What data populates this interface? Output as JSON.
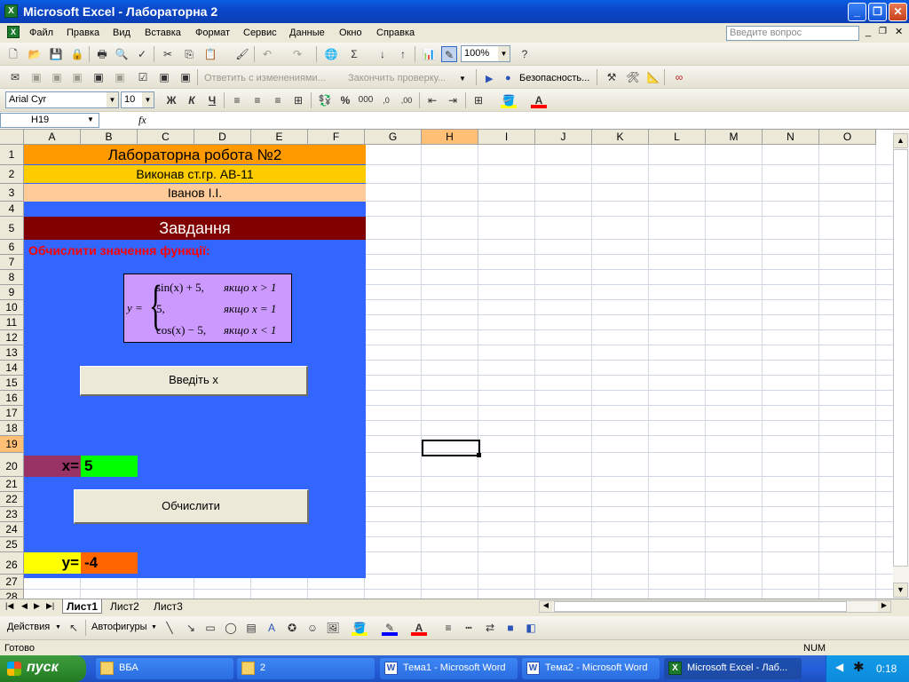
{
  "window": {
    "title": "Microsoft Excel - Лабораторна 2"
  },
  "menu": {
    "items": [
      "Файл",
      "Правка",
      "Вид",
      "Вставка",
      "Формат",
      "Сервис",
      "Данные",
      "Окно",
      "Справка"
    ],
    "ask_placeholder": "Введите вопрос"
  },
  "toolbar": {
    "zoom": "100%",
    "reply_label": "Ответить с изменениями...",
    "finish_label": "Закончить проверку...",
    "security_label": "Безопасность..."
  },
  "format_bar": {
    "font": "Arial Cyr",
    "size": "10",
    "bold": "Ж",
    "italic": "К",
    "underline": "Ч",
    "percent": "%",
    "thousands": "000"
  },
  "formula_bar": {
    "name_box": "H19",
    "fx": "fx",
    "value": ""
  },
  "grid": {
    "columns": [
      "A",
      "B",
      "C",
      "D",
      "E",
      "F",
      "G",
      "H",
      "I",
      "J",
      "K",
      "L",
      "M",
      "N",
      "O"
    ],
    "rows": [
      "1",
      "2",
      "3",
      "4",
      "5",
      "6",
      "7",
      "8",
      "9",
      "10",
      "11",
      "12",
      "13",
      "14",
      "15",
      "16",
      "17",
      "18",
      "19",
      "20",
      "21",
      "22",
      "23",
      "24",
      "25",
      "26",
      "27",
      "28"
    ],
    "selected_col": "H",
    "selected_row": "19"
  },
  "sheet": {
    "title": "Лабораторна робота №2",
    "author_line": "Виконав ст.гр. АВ-11",
    "name": "Іванов І.І.",
    "task_header": "Завдання",
    "task_text": "Обчислити значення функції:",
    "formula": {
      "lhs": "y =",
      "cases": [
        {
          "expr": "sin(x) + 5,",
          "cond": "якщо  x > 1"
        },
        {
          "expr": "5,",
          "cond": "якщо  x = 1"
        },
        {
          "expr": "cos(x) − 5,",
          "cond": "якщо  x < 1"
        }
      ]
    },
    "input_button": "Введіть х",
    "x_label": "x=",
    "x_value": "5",
    "compute_button": "Обчислити",
    "y_label": "y=",
    "y_value": "-4"
  },
  "tabs": [
    "Лист1",
    "Лист2",
    "Лист3"
  ],
  "active_tab": "Лист1",
  "draw_bar": {
    "actions": "Действия",
    "autoshapes": "Автофигуры"
  },
  "status": {
    "left": "Готово",
    "num": "NUM"
  },
  "taskbar": {
    "start": "пуск",
    "tasks": [
      {
        "label": "ВБА",
        "icon": "folder-icon"
      },
      {
        "label": "2",
        "icon": "folder-icon"
      },
      {
        "label": "Тема1 - Microsoft Word",
        "icon": "word-icon"
      },
      {
        "label": "Тема2 - Microsoft Word",
        "icon": "word-icon"
      },
      {
        "label": "Microsoft Excel - Лаб...",
        "icon": "excel-icon"
      }
    ],
    "clock": "0:18"
  },
  "colors": {
    "orange": "#ff9900",
    "gold": "#ffcc00",
    "peach": "#ffcc99",
    "blue": "#3366ff",
    "maroon": "#800000",
    "purple_cell": "#993366",
    "green_cell": "#00ff00",
    "yellow_cell": "#ffff00",
    "orange_cell": "#ff6600",
    "formula_bg": "#cc99ff"
  }
}
